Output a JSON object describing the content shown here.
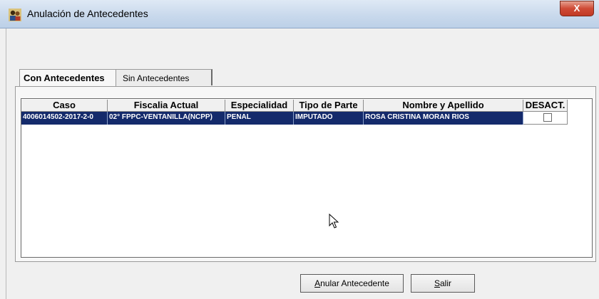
{
  "window": {
    "title": "Anulación de Antecedentes",
    "close_label": "X"
  },
  "tabs": [
    {
      "label": "Con Antecedentes",
      "active": true
    },
    {
      "label": "Sin Antecedentes",
      "active": false
    }
  ],
  "grid": {
    "columns": [
      "Caso",
      "Fiscalia Actual",
      "Especialidad",
      "Tipo de Parte",
      "Nombre y Apellido",
      "DESACT."
    ],
    "rows": [
      {
        "caso": "4006014502-2017-2-0",
        "fiscalia": "02° FPPC-VENTANILLA(NCPP)",
        "especialidad": "PENAL",
        "tipo_parte": "IMPUTADO",
        "nombre": "ROSA CRISTINA MORAN RIOS",
        "desact": false
      }
    ]
  },
  "buttons": {
    "anular_mnemonic": "A",
    "anular_rest": "nular Antecedente",
    "salir_mnemonic": "S",
    "salir_rest": "alir"
  },
  "colors": {
    "selection": "#142a6b",
    "close": "#c13a25"
  },
  "icons": {
    "app": "people-icon",
    "cursor": "mouse-pointer-icon"
  }
}
